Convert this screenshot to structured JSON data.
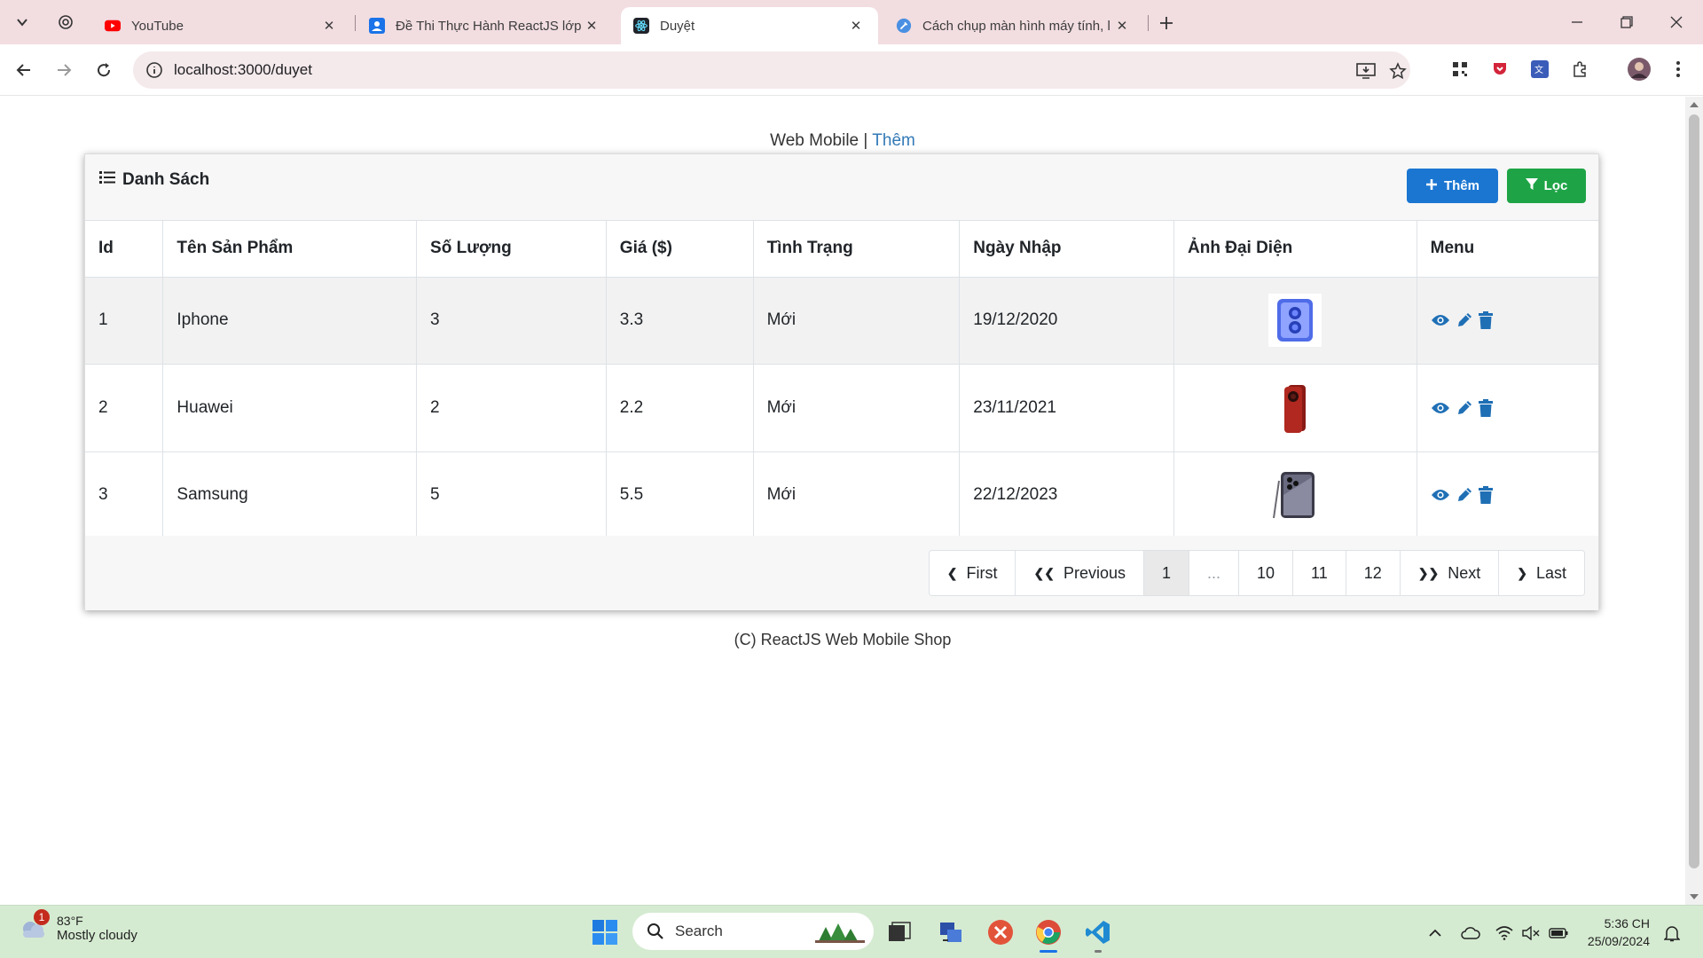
{
  "browser": {
    "tabs": [
      {
        "title": "YouTube",
        "icon": "youtube-icon"
      },
      {
        "title": "Đề Thi Thực Hành ReactJS lớp T",
        "icon": "contacts-icon"
      },
      {
        "title": "Duyệt",
        "icon": "react-icon",
        "active": true
      },
      {
        "title": "Cách chụp màn hình máy tính, l",
        "icon": "tool-icon"
      }
    ],
    "url": "localhost:3000/duyet"
  },
  "page": {
    "nav_brand": "Web Mobile",
    "nav_sep": " | ",
    "nav_link": "Thêm",
    "card_title": "Danh Sách",
    "btn_add": "Thêm",
    "btn_filter": "Lọc",
    "columns": [
      "Id",
      "Tên Sản Phẩm",
      "Số Lượng",
      "Giá ($)",
      "Tình Trạng",
      "Ngày Nhập",
      "Ảnh Đại Diện",
      "Menu"
    ],
    "rows": [
      {
        "id": "1",
        "name": "Iphone",
        "qty": "3",
        "price": "3.3",
        "status": "Mới",
        "date": "19/12/2020",
        "image": "blue-phone-image"
      },
      {
        "id": "2",
        "name": "Huawei",
        "qty": "2",
        "price": "2.2",
        "status": "Mới",
        "date": "23/11/2021",
        "image": "red-phone-image"
      },
      {
        "id": "3",
        "name": "Samsung",
        "qty": "5",
        "price": "5.5",
        "status": "Mới",
        "date": "22/12/2023",
        "image": "gray-phone-image"
      }
    ],
    "pagination": {
      "first": "First",
      "previous": "Previous",
      "pages": [
        "1",
        "...",
        "10",
        "11",
        "12"
      ],
      "current": "1",
      "next": "Next",
      "last": "Last"
    },
    "footer": "(C) ReactJS Web Mobile Shop"
  },
  "taskbar": {
    "weather_temp": "83°F",
    "weather_desc": "Mostly cloudy",
    "weather_badge": "1",
    "search_placeholder": "Search",
    "time": "5:36 CH",
    "date": "25/09/2024"
  },
  "colors": {
    "primary": "#1b76d1",
    "success": "#1ea446",
    "icon_blue": "#1f6fb5",
    "link": "#337ab7"
  }
}
